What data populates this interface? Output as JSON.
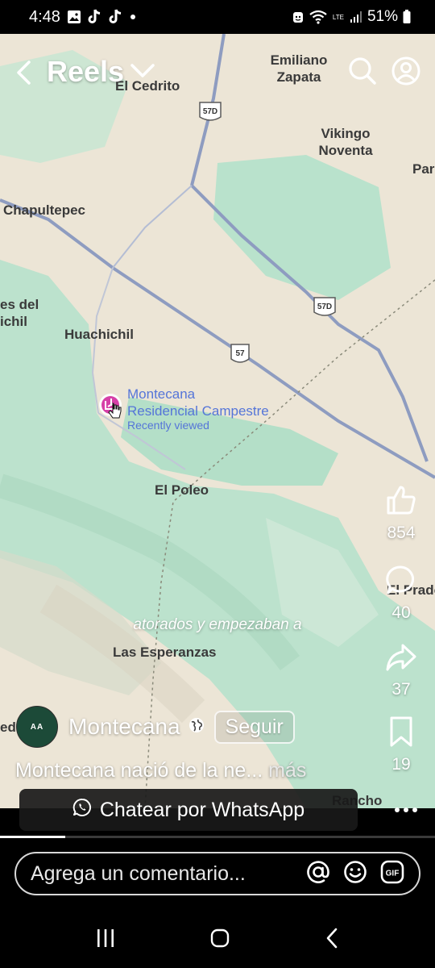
{
  "status_bar": {
    "time": "4:48",
    "battery": "51%",
    "network": "LTE"
  },
  "header": {
    "title": "Reels"
  },
  "map": {
    "labels": {
      "emiliano_zapata": "Emiliano\nZapata",
      "el_cedrito": "El Cedrito",
      "vikingo_noventa": "Vikingo\nNoventa",
      "par": "Par",
      "chapultepec": "Chapultepec",
      "es_del_ichil": "es del\nichil",
      "huachichil": "Huachichil",
      "el_poleo": "El Poleo",
      "el_prado": "El Prado",
      "las_esperanzas": "Las Esperanzas",
      "rancho": "Rancho",
      "edi": "edi"
    },
    "shields": {
      "s1": "57D",
      "s2": "57D",
      "s3": "57"
    },
    "place": {
      "name": "Montecana\nResidencial Campestre",
      "status": "Recently viewed"
    }
  },
  "reel": {
    "caption_overlay": "atorados y empezaban a",
    "author": "Montecana",
    "avatar_text": "AA",
    "follow_label": "Seguir",
    "description": "Montecana nació de la ne...",
    "more_label": "más",
    "whatsapp_label": "Chatear por WhatsApp",
    "likes": "854",
    "comments": "40",
    "shares": "37",
    "saves": "19",
    "progress": 0.15
  },
  "comment_bar": {
    "placeholder": "Agrega un comentario..."
  },
  "colors": {
    "map_base": "#ece5d6",
    "map_green": "#b9e2cc",
    "road": "#8e9cc0",
    "place_text": "#5575d8",
    "pin": "#d640a8"
  }
}
